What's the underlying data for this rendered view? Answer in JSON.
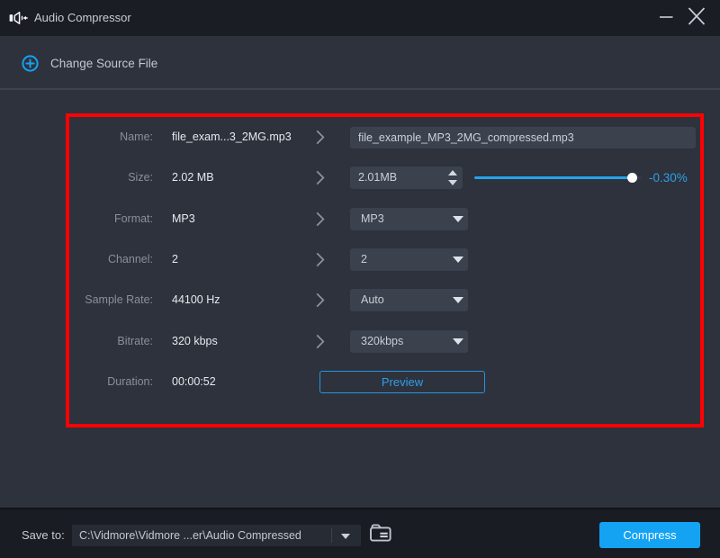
{
  "window": {
    "title": "Audio Compressor",
    "controls": {
      "minimize": "minimize",
      "close": "close"
    }
  },
  "header": {
    "change_source_label": "Change Source File"
  },
  "annotation": {
    "highlight_color": "#fd0105"
  },
  "form": {
    "rows": [
      {
        "label": "Name:",
        "value": "file_exam...3_2MG.mp3",
        "control": "text",
        "input_value": "file_example_MP3_2MG_compressed.mp3"
      },
      {
        "label": "Size:",
        "value": "2.02 MB",
        "control": "spinner",
        "input_value": "2.01MB",
        "slider_percent": 94,
        "readout": "-0.30%"
      },
      {
        "label": "Format:",
        "value": "MP3",
        "control": "select",
        "selected": "MP3"
      },
      {
        "label": "Channel:",
        "value": "2",
        "control": "select",
        "selected": "2"
      },
      {
        "label": "Sample Rate:",
        "value": "44100 Hz",
        "control": "select",
        "selected": "Auto"
      },
      {
        "label": "Bitrate:",
        "value": "320 kbps",
        "control": "select",
        "selected": "320kbps"
      },
      {
        "label": "Duration:",
        "value": "00:00:52",
        "control": "button",
        "button_label": "Preview"
      }
    ]
  },
  "footer": {
    "save_to_label": "Save to:",
    "path": "C:\\Vidmore\\Vidmore ...er\\Audio Compressed",
    "compress_label": "Compress"
  },
  "colors": {
    "accent_blue": "#14a3f3",
    "slider_blue": "#26a3ec",
    "text_blue": "#2f9fe9",
    "background": "#2d323d",
    "titlebar": "#1a1d24",
    "control_bg": "#3b414d",
    "highlight_red": "#fd0105"
  }
}
